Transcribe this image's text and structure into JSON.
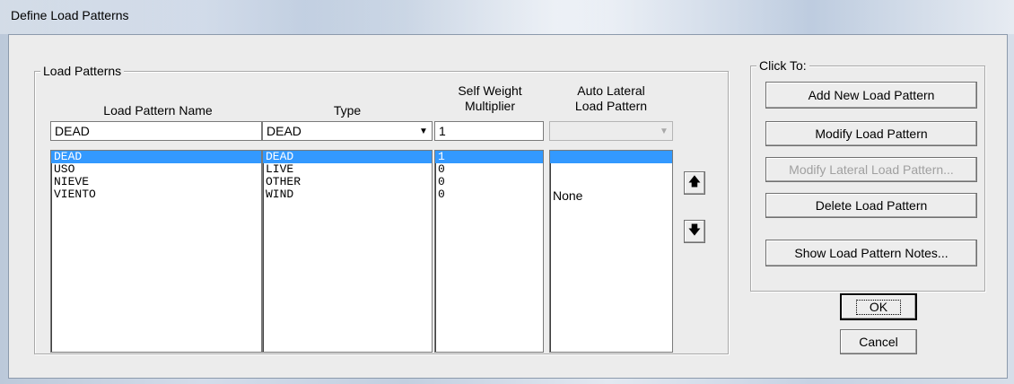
{
  "window": {
    "title": "Define Load Patterns"
  },
  "load_patterns": {
    "group_label": "Load Patterns",
    "headers": {
      "name": "Load Pattern Name",
      "type": "Type",
      "multiplier_line1": "Self Weight",
      "multiplier_line2": "Multiplier",
      "auto_line1": "Auto Lateral",
      "auto_line2": "Load Pattern"
    },
    "edit": {
      "name": "DEAD",
      "type": "DEAD",
      "multiplier": "1",
      "auto": ""
    },
    "rows": [
      {
        "name": "DEAD",
        "type": "DEAD",
        "multiplier": "1",
        "auto": "",
        "selected": true
      },
      {
        "name": "USO",
        "type": "LIVE",
        "multiplier": "0",
        "auto": "",
        "selected": false
      },
      {
        "name": "NIEVE",
        "type": "OTHER",
        "multiplier": "0",
        "auto": "",
        "selected": false
      },
      {
        "name": "VIENTO",
        "type": "WIND",
        "multiplier": "0",
        "auto": "None",
        "selected": false
      }
    ]
  },
  "click_to": {
    "group_label": "Click To:",
    "add": "Add New Load Pattern",
    "modify": "Modify Load Pattern",
    "modify_lateral": "Modify Lateral Load Pattern...",
    "delete": "Delete Load Pattern",
    "notes": "Show Load Pattern Notes..."
  },
  "buttons": {
    "ok": "OK",
    "cancel": "Cancel"
  },
  "icons": {
    "move_up": "arrow-up-icon",
    "move_down": "arrow-down-icon",
    "dropdown": "chevron-down-icon"
  }
}
